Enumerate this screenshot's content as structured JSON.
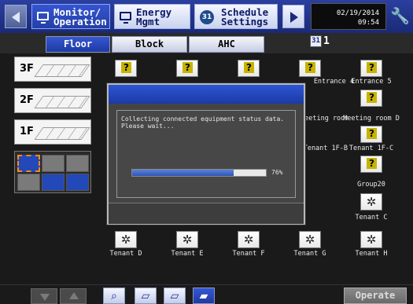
{
  "topbar": {
    "monitor_operation": {
      "line1": "Monitor/",
      "line2": "Operation"
    },
    "energy_mgmt": {
      "line1": "Energy",
      "line2": "Mgmt"
    },
    "schedule_settings": {
      "line1": "Schedule",
      "line2": "Settings",
      "calendar_day": "31"
    },
    "date": "02/19/2014",
    "time": "09:54"
  },
  "tabs": [
    {
      "label": "Floor"
    },
    {
      "label": "Block"
    },
    {
      "label": "AHC"
    }
  ],
  "group_indicator": {
    "icon_text": "31",
    "value": "1"
  },
  "floors": [
    {
      "label": "3F"
    },
    {
      "label": "2F"
    },
    {
      "label": "1F"
    }
  ],
  "groups": [
    {
      "label": "Entrance 4",
      "icon": "unknown-status-icon"
    },
    {
      "label": "Entrance 5",
      "icon": "unknown-status-icon"
    },
    {
      "label": "Meeting room C",
      "icon": "unknown-status-icon"
    },
    {
      "label": "Meeting room D",
      "icon": "unknown-status-icon"
    },
    {
      "label": "Tenant 1F-B",
      "icon": "unknown-status-icon"
    },
    {
      "label": "Tenant 1F-C",
      "icon": "unknown-status-icon"
    },
    {
      "label": "Group20",
      "icon": "unknown-status-icon"
    },
    {
      "label": "Tenant C",
      "icon": "fan-icon"
    },
    {
      "label": "Tenant D",
      "icon": "fan-icon"
    },
    {
      "label": "Tenant E",
      "icon": "fan-icon"
    },
    {
      "label": "Tenant F",
      "icon": "fan-icon"
    },
    {
      "label": "Tenant G",
      "icon": "fan-icon"
    },
    {
      "label": "Tenant H",
      "icon": "fan-icon"
    }
  ],
  "dialog": {
    "message_line1": "Collecting connected equipment status data.",
    "message_line2": "Please wait...",
    "progress_percent": 76,
    "progress_label": "76%"
  },
  "bottombar": {
    "operate_label": "Operate"
  },
  "colors": {
    "accent_blue": "#2340a8",
    "unknown_icon": "#c8b400",
    "selection_border": "#ff8a1a"
  }
}
